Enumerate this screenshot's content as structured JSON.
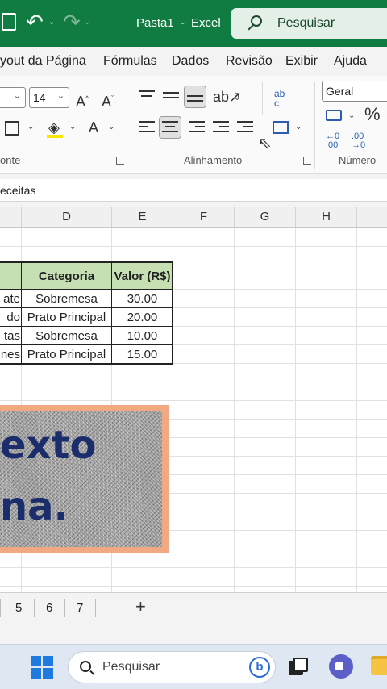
{
  "titlebar": {
    "doc_name": "Pasta1",
    "separator": "-",
    "app_name": "Excel",
    "search_label": "Pesquisar"
  },
  "ribbon_tabs": [
    "yout da Página",
    "Fórmulas",
    "Dados",
    "Revisão",
    "Exibir",
    "Ajuda"
  ],
  "ribbon": {
    "font_size": "14",
    "number_format": "Geral",
    "percent_symbol": "%",
    "group_labels": {
      "font": "onte",
      "alignment": "Alinhamento",
      "number": "Número"
    },
    "wrap_icon_text": "ab c",
    "inc_decimal": "←0 .00",
    "dec_decimal": ".00 →0"
  },
  "formula_bar": {
    "value": "eceitas"
  },
  "columns": [
    "D",
    "E",
    "F",
    "G",
    "H"
  ],
  "table": {
    "headers": [
      "Categoria",
      "Valor (R$)"
    ],
    "rows": [
      {
        "a": "ate",
        "categoria": "Sobremesa",
        "valor": "30.00"
      },
      {
        "a": "do",
        "categoria": "Prato Principal",
        "valor": "20.00"
      },
      {
        "a": "tas",
        "categoria": "Sobremesa",
        "valor": "10.00"
      },
      {
        "a": "nes",
        "categoria": "Prato Principal",
        "valor": "15.00"
      }
    ],
    "header_fill": "#c6e0b4"
  },
  "overlay": {
    "line1": "exto",
    "line2": "na."
  },
  "sheet_tabs": [
    "5",
    "6",
    "7"
  ],
  "add_sheet": "+",
  "taskbar": {
    "search_label": "Pesquisar",
    "bing_letter": "b"
  },
  "colors": {
    "excel_green": "#107c41",
    "text_overlay": "#1c2d6b",
    "overlay_border": "#f0a983"
  }
}
